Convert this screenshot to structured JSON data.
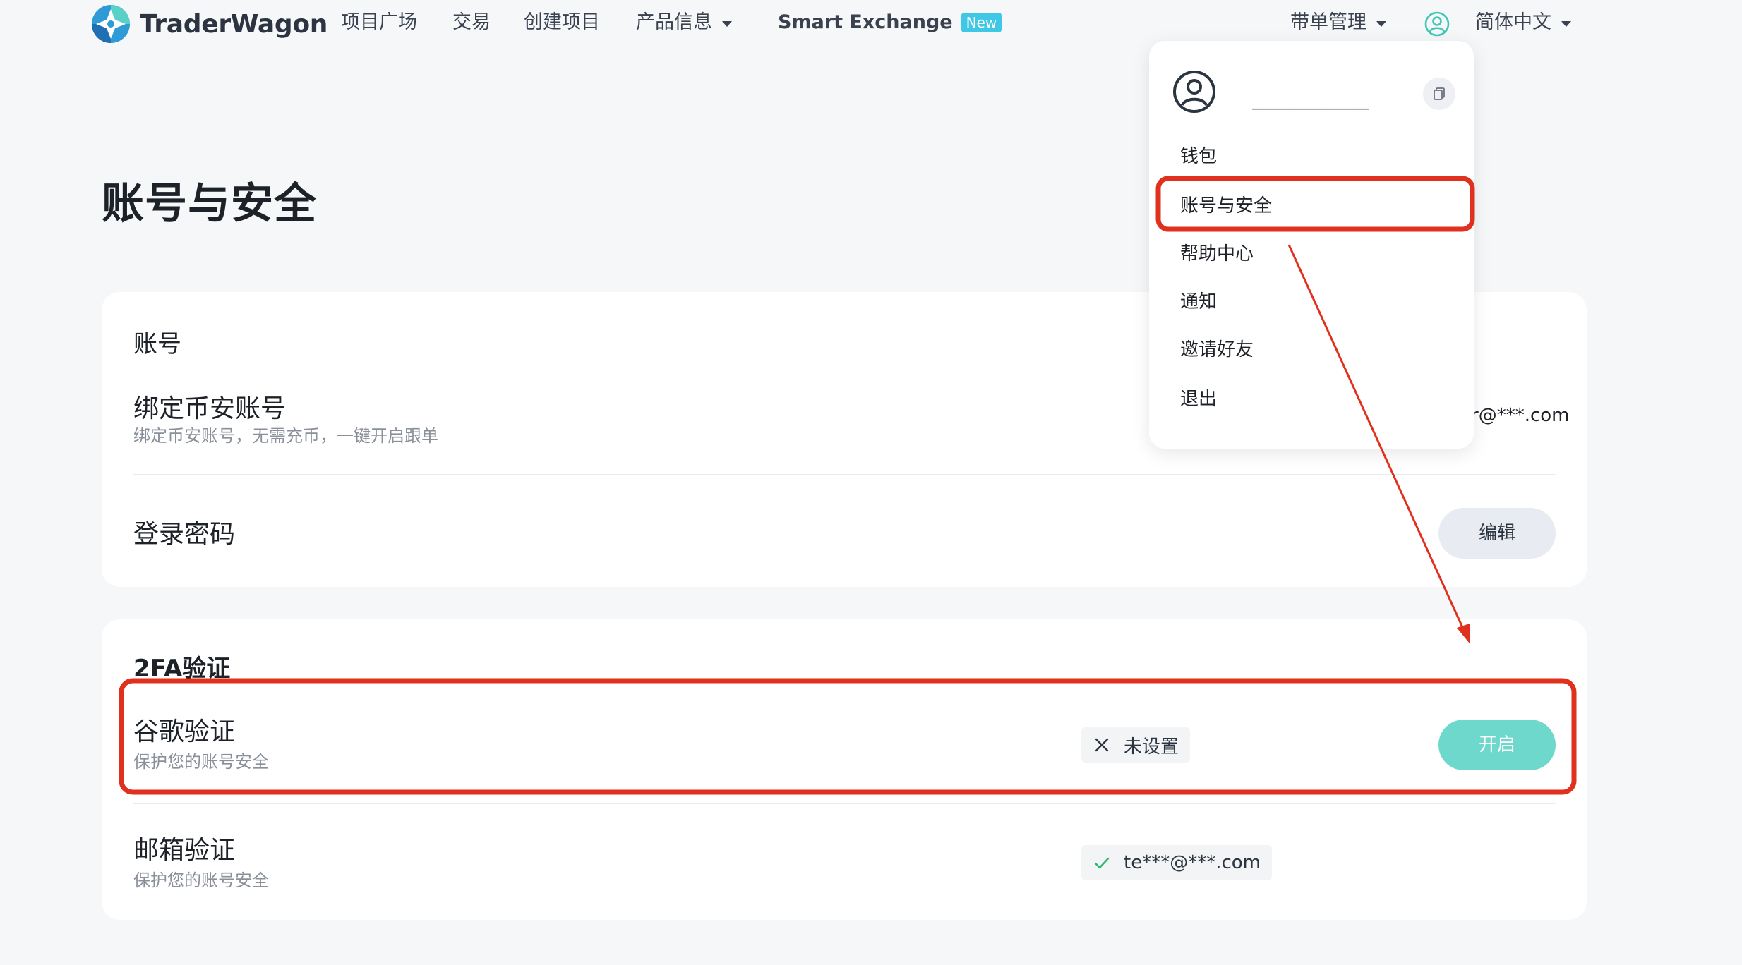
{
  "topnav": {
    "brand": "TraderWagon",
    "items": [
      "项目广场",
      "交易",
      "创建项目",
      "产品信息"
    ],
    "smart_exchange": "Smart Exchange",
    "new_badge": "New",
    "copy_trade_manage": "带单管理",
    "language": "简体中文"
  },
  "page": {
    "title": "账号与安全"
  },
  "account_card": {
    "section_title": "账号",
    "bind_binance": {
      "title": "绑定币安账号",
      "subtitle": "绑定币安账号，无需充币，一键开启跟单",
      "value_fragment": "r@***.com"
    },
    "login_password": {
      "title": "登录密码",
      "button": "编辑"
    }
  },
  "twofa_card": {
    "section_title": "2FA验证",
    "google": {
      "title": "谷歌验证",
      "subtitle": "保护您的账号安全",
      "status": "未设置",
      "button": "开启"
    },
    "email": {
      "title": "邮箱验证",
      "subtitle": "保护您的账号安全",
      "status": "te***@***.com"
    }
  },
  "user_menu": {
    "name_partial": "_ _ _ _ _",
    "id_partial": "_______________",
    "items": [
      "钱包",
      "账号与安全",
      "帮助中心",
      "通知",
      "邀请好友",
      "退出"
    ]
  },
  "colors": {
    "accent_teal": "#6fd8cc",
    "annotation_red": "#e0301e",
    "new_badge": "#3fc7e6",
    "page_bg": "#f6f7f9"
  }
}
